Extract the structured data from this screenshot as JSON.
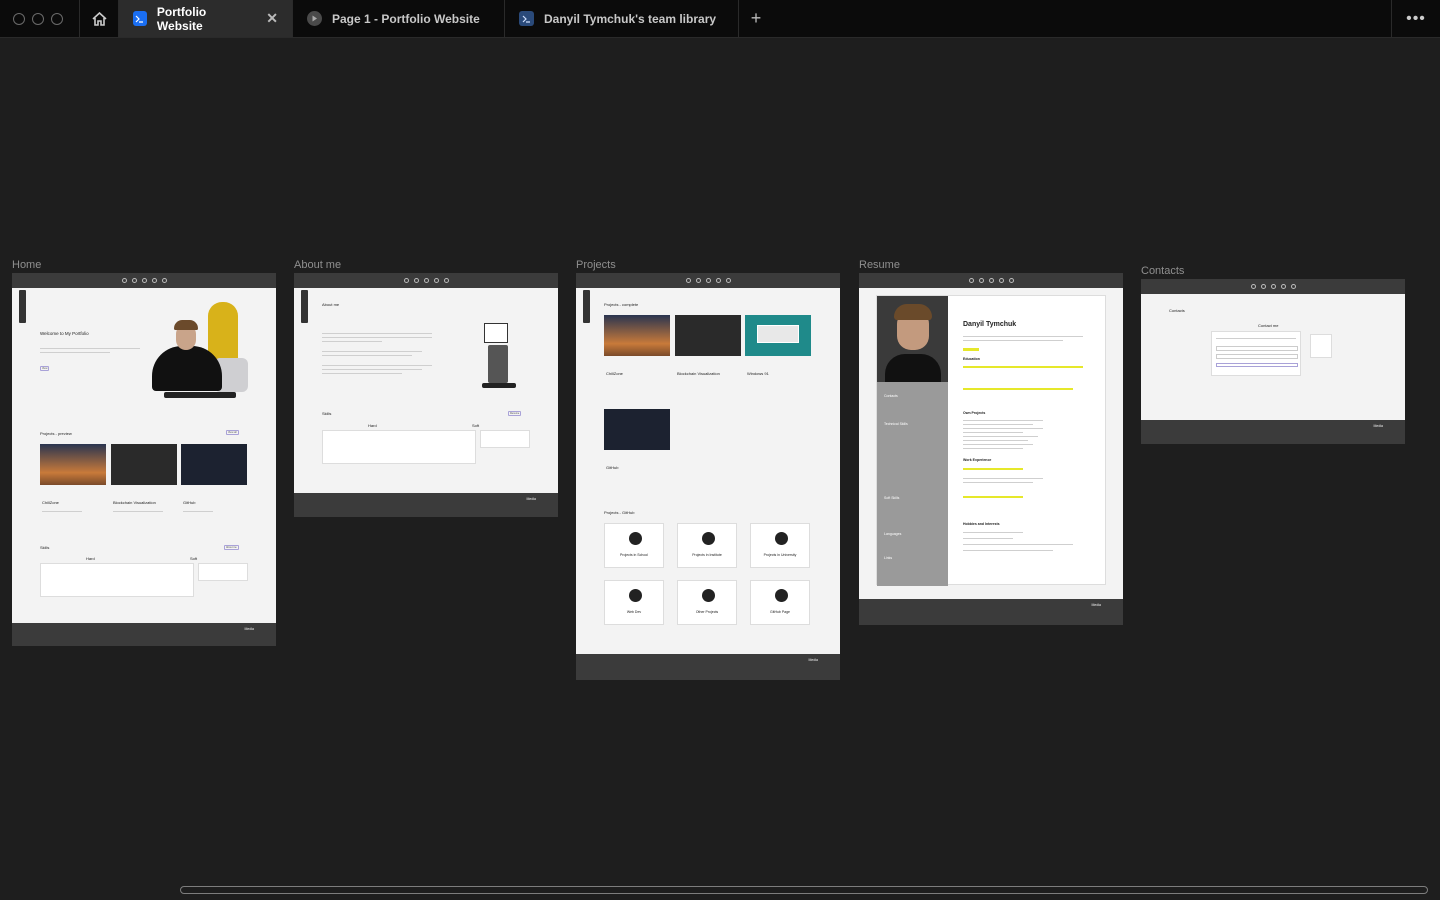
{
  "tabs": {
    "home_icon": "home-icon",
    "items": [
      {
        "label": "Portfolio Website",
        "icon": "figma-file-icon",
        "active": true
      },
      {
        "label": "Page 1 - Portfolio Website",
        "icon": "prototype-play-icon",
        "active": false
      },
      {
        "label": "Danyil Tymchuk's team library",
        "icon": "library-icon",
        "active": false
      }
    ],
    "close_glyph": "✕",
    "new_tab_glyph": "+",
    "more_glyph": "•••"
  },
  "frames": {
    "home": {
      "label": "Home",
      "welcome": "Welcome to My Portfolio",
      "projects_title": "Projects - preview",
      "projects": [
        "ChillZone",
        "Blockchain Visualization",
        "GitHub"
      ],
      "skills_title": "Skills",
      "hard": "Hard",
      "soft": "Soft",
      "footer_media": "Media"
    },
    "about": {
      "label": "About me",
      "title": "About me",
      "skills_title": "Skills",
      "hard": "Hard",
      "soft": "Soft",
      "footer_media": "Media"
    },
    "projects": {
      "label": "Projects",
      "complete_title": "Projects - complete",
      "projects": [
        "ChillZone",
        "Blockchain Visualization",
        "Windows 91",
        "GitHub"
      ],
      "github_title": "Projects - GitHub",
      "github_cards": [
        "Projects in School",
        "Projects in Institute",
        "Projects in University",
        "Web Dev",
        "Other Projects",
        "GitHub Page"
      ],
      "footer_media": "Media"
    },
    "resume": {
      "label": "Resume",
      "name": "Danyil Tymchuk",
      "education": "Education",
      "own_projects": "Own Projects",
      "work": "Work Experience",
      "hobbies": "Hobbies and Interests",
      "contacts": "Contacts",
      "tech_skills": "Technical Skills",
      "soft_skills": "Soft Skills",
      "languages": "Languages",
      "links": "Links",
      "footer_media": "Media"
    },
    "contacts": {
      "label": "Contacts",
      "title": "Contacts",
      "form_title": "Contact me",
      "footer_media": "Media"
    }
  }
}
